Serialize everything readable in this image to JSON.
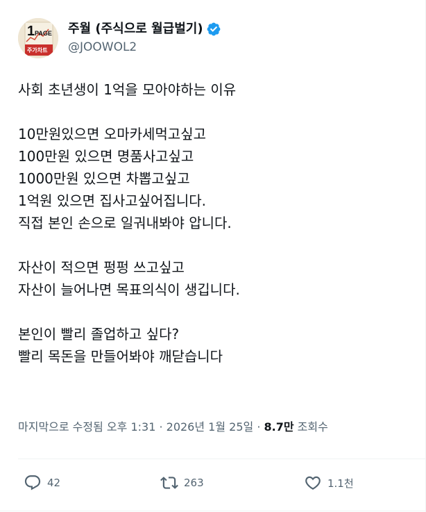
{
  "author": {
    "display_name": "주월 (주식으로 월급벌기)",
    "handle": "@JOOWOL2",
    "verified": true,
    "avatar": {
      "line1": "1",
      "line2": "PAGE",
      "line3": "주가차트"
    }
  },
  "post": {
    "lines": [
      "사회 초년생이 1억을 모아야하는 이유",
      "",
      "10만원있으면 오마카세먹고싶고",
      "100만원 있으면 명품사고싶고",
      "1000만원 있으면 차뽑고싶고",
      "1억원 있으면 집사고싶어집니다.",
      "직접 본인 손으로 일궈내봐야 압니다.",
      "",
      "자산이 적으면 펑펑 쓰고싶고",
      "자산이 늘어나면 목표의식이 생깁니다.",
      "",
      "본인이 빨리 졸업하고 싶다?",
      "빨리 목돈을 만들어봐야 깨닫습니다"
    ]
  },
  "meta": {
    "edited_label": "마지막으로 수정됨 오후 1:31 · 2026년 1월 25일 · ",
    "views_count": "8.7만",
    "views_label": " 조회수"
  },
  "actions": {
    "reply_count": "42",
    "retweet_count": "263",
    "like_count": "1.1천"
  },
  "colors": {
    "text": "#0f1419",
    "secondary": "#536471",
    "verified": "#1d9bf0",
    "divider": "#eff3f4"
  }
}
